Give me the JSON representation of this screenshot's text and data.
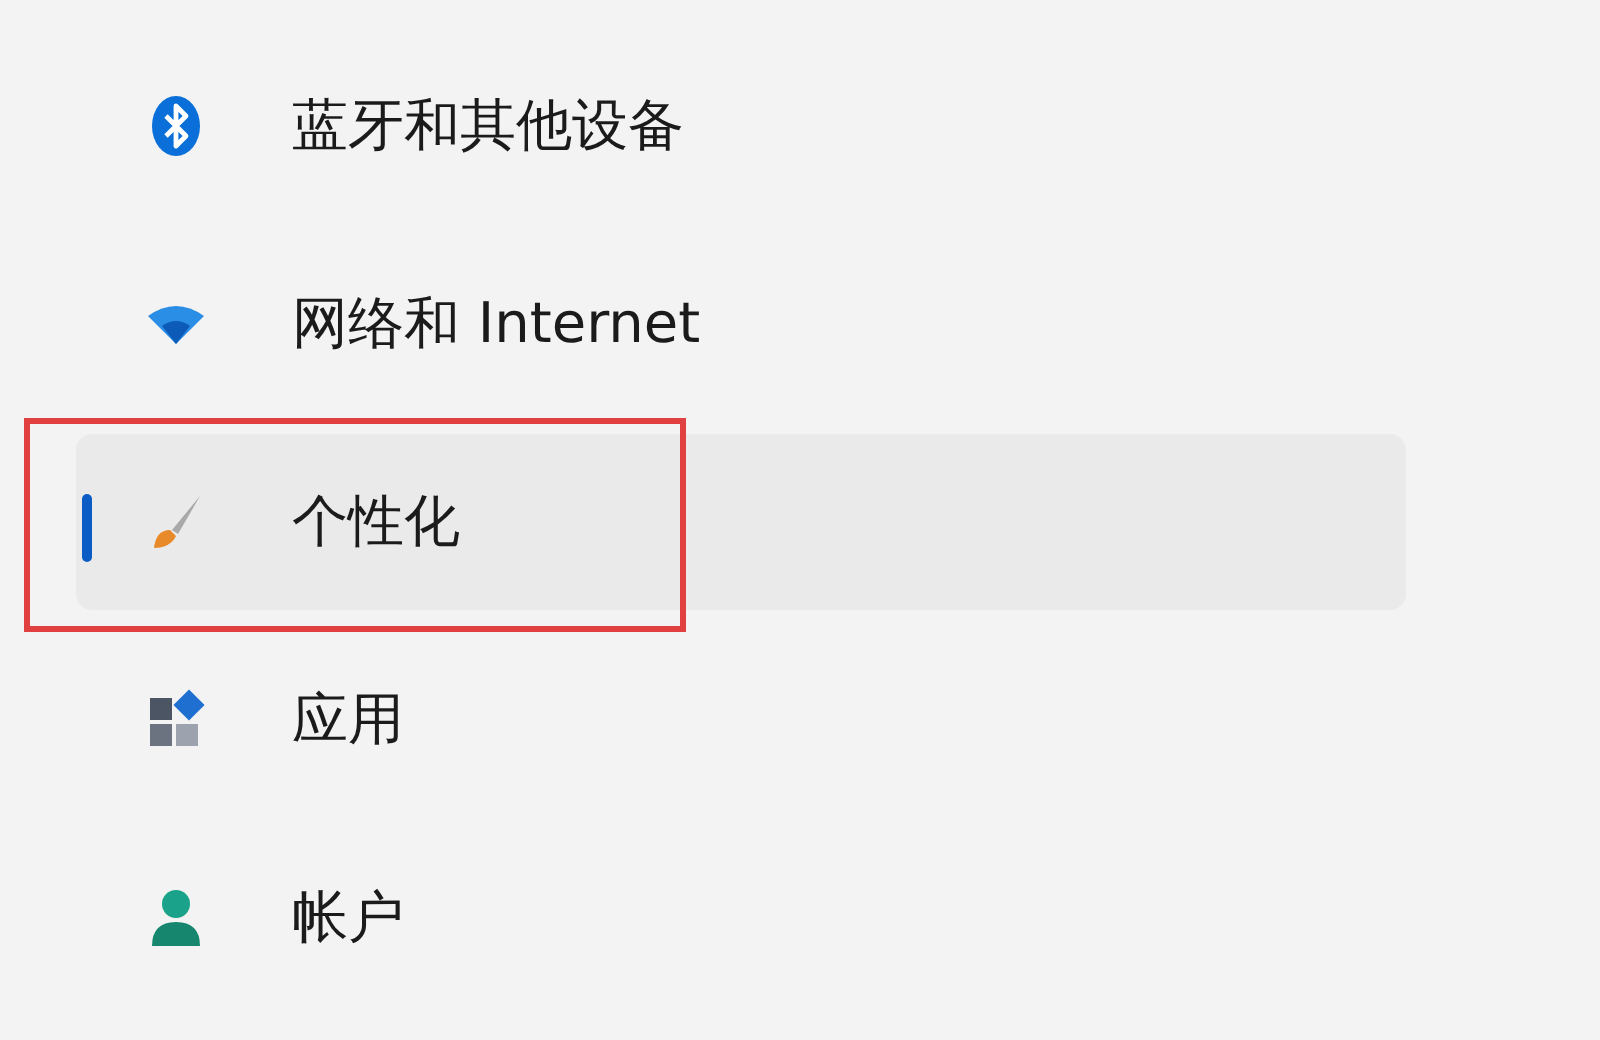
{
  "sidebar": {
    "items": [
      {
        "kind": "bluetooth",
        "label": "蓝牙和其他设备",
        "selected": false,
        "annotated": false
      },
      {
        "kind": "network",
        "label": "网络和 Internet",
        "selected": false,
        "annotated": false
      },
      {
        "kind": "personalization",
        "label": "个性化",
        "selected": true,
        "annotated": true
      },
      {
        "kind": "apps",
        "label": "应用",
        "selected": false,
        "annotated": false
      },
      {
        "kind": "accounts",
        "label": "帐户",
        "selected": false,
        "annotated": false
      }
    ]
  }
}
